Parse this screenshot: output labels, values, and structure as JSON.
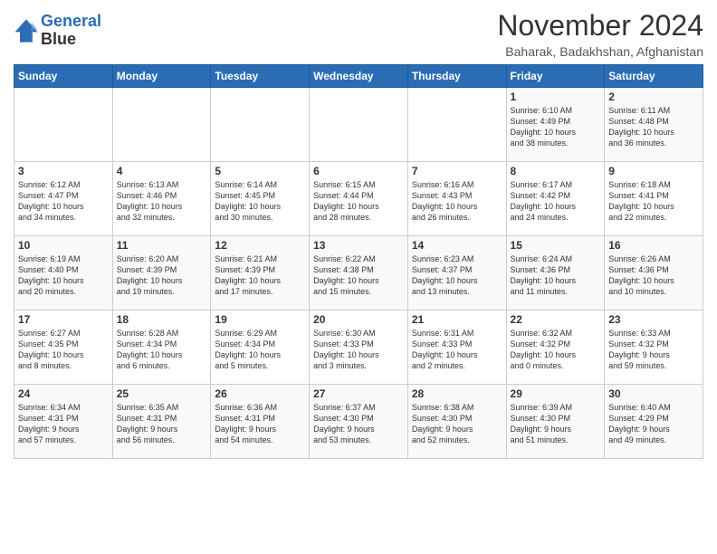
{
  "header": {
    "logo_line1": "General",
    "logo_line2": "Blue",
    "month_title": "November 2024",
    "subtitle": "Baharak, Badakhshan, Afghanistan"
  },
  "weekdays": [
    "Sunday",
    "Monday",
    "Tuesday",
    "Wednesday",
    "Thursday",
    "Friday",
    "Saturday"
  ],
  "weeks": [
    [
      {
        "day": "",
        "info": ""
      },
      {
        "day": "",
        "info": ""
      },
      {
        "day": "",
        "info": ""
      },
      {
        "day": "",
        "info": ""
      },
      {
        "day": "",
        "info": ""
      },
      {
        "day": "1",
        "info": "Sunrise: 6:10 AM\nSunset: 4:49 PM\nDaylight: 10 hours\nand 38 minutes."
      },
      {
        "day": "2",
        "info": "Sunrise: 6:11 AM\nSunset: 4:48 PM\nDaylight: 10 hours\nand 36 minutes."
      }
    ],
    [
      {
        "day": "3",
        "info": "Sunrise: 6:12 AM\nSunset: 4:47 PM\nDaylight: 10 hours\nand 34 minutes."
      },
      {
        "day": "4",
        "info": "Sunrise: 6:13 AM\nSunset: 4:46 PM\nDaylight: 10 hours\nand 32 minutes."
      },
      {
        "day": "5",
        "info": "Sunrise: 6:14 AM\nSunset: 4:45 PM\nDaylight: 10 hours\nand 30 minutes."
      },
      {
        "day": "6",
        "info": "Sunrise: 6:15 AM\nSunset: 4:44 PM\nDaylight: 10 hours\nand 28 minutes."
      },
      {
        "day": "7",
        "info": "Sunrise: 6:16 AM\nSunset: 4:43 PM\nDaylight: 10 hours\nand 26 minutes."
      },
      {
        "day": "8",
        "info": "Sunrise: 6:17 AM\nSunset: 4:42 PM\nDaylight: 10 hours\nand 24 minutes."
      },
      {
        "day": "9",
        "info": "Sunrise: 6:18 AM\nSunset: 4:41 PM\nDaylight: 10 hours\nand 22 minutes."
      }
    ],
    [
      {
        "day": "10",
        "info": "Sunrise: 6:19 AM\nSunset: 4:40 PM\nDaylight: 10 hours\nand 20 minutes."
      },
      {
        "day": "11",
        "info": "Sunrise: 6:20 AM\nSunset: 4:39 PM\nDaylight: 10 hours\nand 19 minutes."
      },
      {
        "day": "12",
        "info": "Sunrise: 6:21 AM\nSunset: 4:39 PM\nDaylight: 10 hours\nand 17 minutes."
      },
      {
        "day": "13",
        "info": "Sunrise: 6:22 AM\nSunset: 4:38 PM\nDaylight: 10 hours\nand 15 minutes."
      },
      {
        "day": "14",
        "info": "Sunrise: 6:23 AM\nSunset: 4:37 PM\nDaylight: 10 hours\nand 13 minutes."
      },
      {
        "day": "15",
        "info": "Sunrise: 6:24 AM\nSunset: 4:36 PM\nDaylight: 10 hours\nand 11 minutes."
      },
      {
        "day": "16",
        "info": "Sunrise: 6:26 AM\nSunset: 4:36 PM\nDaylight: 10 hours\nand 10 minutes."
      }
    ],
    [
      {
        "day": "17",
        "info": "Sunrise: 6:27 AM\nSunset: 4:35 PM\nDaylight: 10 hours\nand 8 minutes."
      },
      {
        "day": "18",
        "info": "Sunrise: 6:28 AM\nSunset: 4:34 PM\nDaylight: 10 hours\nand 6 minutes."
      },
      {
        "day": "19",
        "info": "Sunrise: 6:29 AM\nSunset: 4:34 PM\nDaylight: 10 hours\nand 5 minutes."
      },
      {
        "day": "20",
        "info": "Sunrise: 6:30 AM\nSunset: 4:33 PM\nDaylight: 10 hours\nand 3 minutes."
      },
      {
        "day": "21",
        "info": "Sunrise: 6:31 AM\nSunset: 4:33 PM\nDaylight: 10 hours\nand 2 minutes."
      },
      {
        "day": "22",
        "info": "Sunrise: 6:32 AM\nSunset: 4:32 PM\nDaylight: 10 hours\nand 0 minutes."
      },
      {
        "day": "23",
        "info": "Sunrise: 6:33 AM\nSunset: 4:32 PM\nDaylight: 9 hours\nand 59 minutes."
      }
    ],
    [
      {
        "day": "24",
        "info": "Sunrise: 6:34 AM\nSunset: 4:31 PM\nDaylight: 9 hours\nand 57 minutes."
      },
      {
        "day": "25",
        "info": "Sunrise: 6:35 AM\nSunset: 4:31 PM\nDaylight: 9 hours\nand 56 minutes."
      },
      {
        "day": "26",
        "info": "Sunrise: 6:36 AM\nSunset: 4:31 PM\nDaylight: 9 hours\nand 54 minutes."
      },
      {
        "day": "27",
        "info": "Sunrise: 6:37 AM\nSunset: 4:30 PM\nDaylight: 9 hours\nand 53 minutes."
      },
      {
        "day": "28",
        "info": "Sunrise: 6:38 AM\nSunset: 4:30 PM\nDaylight: 9 hours\nand 52 minutes."
      },
      {
        "day": "29",
        "info": "Sunrise: 6:39 AM\nSunset: 4:30 PM\nDaylight: 9 hours\nand 51 minutes."
      },
      {
        "day": "30",
        "info": "Sunrise: 6:40 AM\nSunset: 4:29 PM\nDaylight: 9 hours\nand 49 minutes."
      }
    ]
  ]
}
